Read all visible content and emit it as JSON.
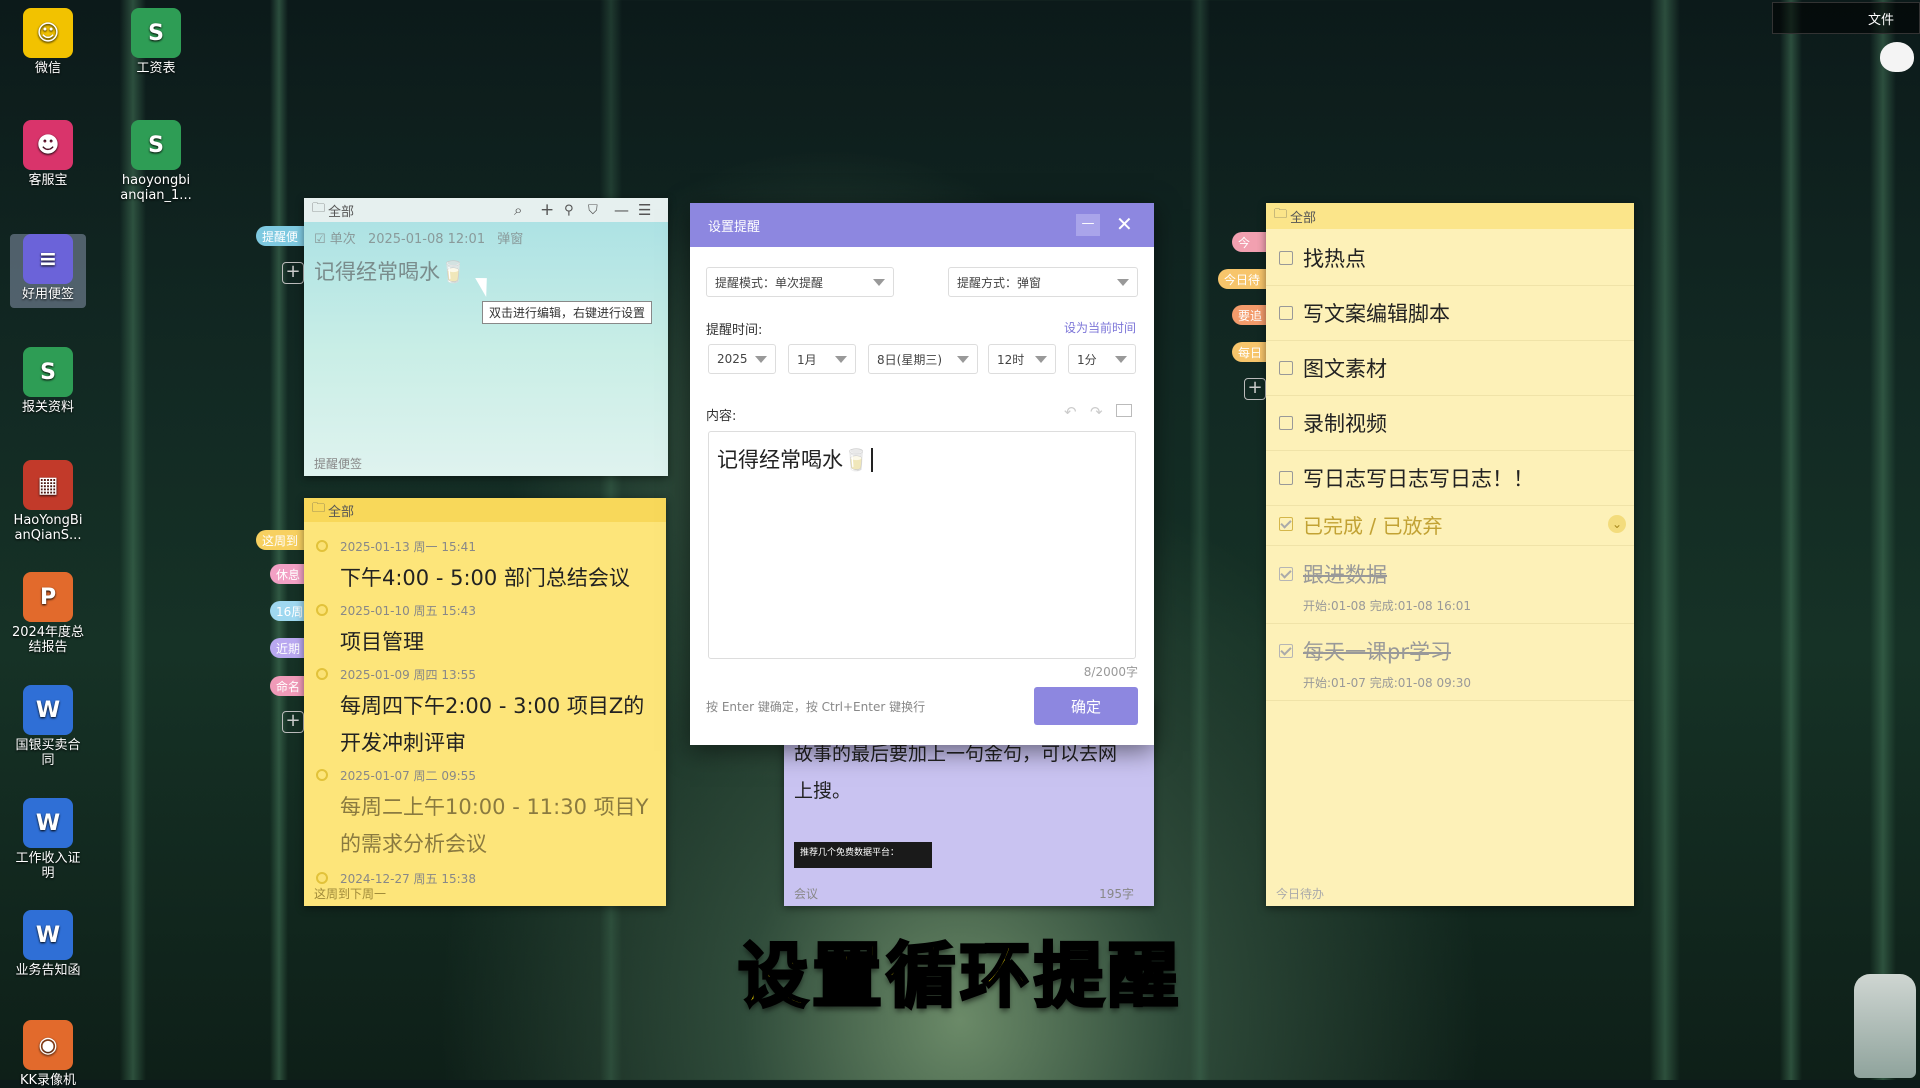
{
  "desktop_icons": [
    {
      "label": "微信",
      "color": "#f2c200",
      "glyph": "☺"
    },
    {
      "label": "工资表",
      "color": "#2e9d55",
      "glyph": "S"
    },
    {
      "label": "客服宝",
      "color": "#d9346b",
      "glyph": "☻"
    },
    {
      "label": "haoyongbianqian_1...",
      "color": "#2e9d55",
      "glyph": "S"
    },
    {
      "label": "好用便签",
      "color": "#6b63d9",
      "glyph": "≡"
    },
    {
      "label": "报关资料",
      "color": "#2e9d55",
      "glyph": "S"
    },
    {
      "label": "HaoYongBianQianS...",
      "color": "#c23a2a",
      "glyph": "▦"
    },
    {
      "label": "2024年度总结报告",
      "color": "#e26a2c",
      "glyph": "P"
    },
    {
      "label": "国银买卖合同",
      "color": "#2f6fd6",
      "glyph": "W"
    },
    {
      "label": "工作收入证明",
      "color": "#2f6fd6",
      "glyph": "W"
    },
    {
      "label": "业务告知函",
      "color": "#2f6fd6",
      "glyph": "W"
    },
    {
      "label": "KK录像机",
      "color": "#e26a2c",
      "glyph": "◉"
    }
  ],
  "top_right": {
    "file_label": "文件"
  },
  "note_reminder": {
    "folder": "全部",
    "meta_type": "单次",
    "meta_time": "2025-01-08 12:01",
    "meta_mode": "弹窗",
    "content": "记得经常喝水🥛",
    "tooltip": "双击进行编辑，右键进行设置",
    "footer": "提醒便签",
    "side_tag": "提醒便"
  },
  "note_calendar": {
    "folder": "全部",
    "side_tags": [
      "这周到",
      "休息",
      "16周",
      "近期",
      "命名"
    ],
    "events": [
      {
        "date": "2025-01-13 周一 15:41",
        "text": "下午4:00 - 5:00 部门总结会议",
        "done": false
      },
      {
        "date": "2025-01-10 周五 15:43",
        "text": "项目管理",
        "done": false
      },
      {
        "date": "2025-01-09 周四 13:55",
        "text": "每周四下午2:00 - 3:00 项目Z的开发冲刺评审",
        "done": false
      },
      {
        "date": "2025-01-07 周二 09:55",
        "text": "每周二上午10:00 - 11:30 项目Y的需求分析会议",
        "done": true
      },
      {
        "date": "2024-12-27 周五 15:38",
        "text": "",
        "done": false
      }
    ],
    "footer": "这周到下周一"
  },
  "note_purple": {
    "text": "故事的最后要加上一句金句，可以去网上搜。",
    "thumb_text": "推荐几个免费数据平台：",
    "footer_left": "会议",
    "footer_right": "195字"
  },
  "dialog": {
    "title": "设置提醒",
    "mode_label": "提醒模式：单次提醒",
    "method_label": "提醒方式：弹窗",
    "time_label": "提醒时间:",
    "set_now": "设为当前时间",
    "year": "2025",
    "month": "1月",
    "day": "8日(星期三)",
    "hour": "12时",
    "minute": "1分",
    "content_label": "内容:",
    "content": "记得经常喝水🥛",
    "counter": "8/2000字",
    "hint": "按 Enter 键确定，按 Ctrl+Enter 键换行",
    "confirm": "确定"
  },
  "note_todo": {
    "folder": "全部",
    "side_tags": [
      "今",
      "今日待",
      "要追",
      "每日"
    ],
    "items": [
      "找热点",
      "写文案编辑脚本",
      "图文素材",
      "录制视频",
      "写日志写日志写日志！！"
    ],
    "done_header": "已完成 / 已放弃",
    "done_items": [
      {
        "text": "跟进数据",
        "meta": "开始:01-08  完成:01-08 16:01"
      },
      {
        "text": "每天一课pr学习",
        "meta": "开始:01-07  完成:01-08 09:30"
      }
    ],
    "footer": "今日待办"
  },
  "subtitle": "设置循环提醒"
}
